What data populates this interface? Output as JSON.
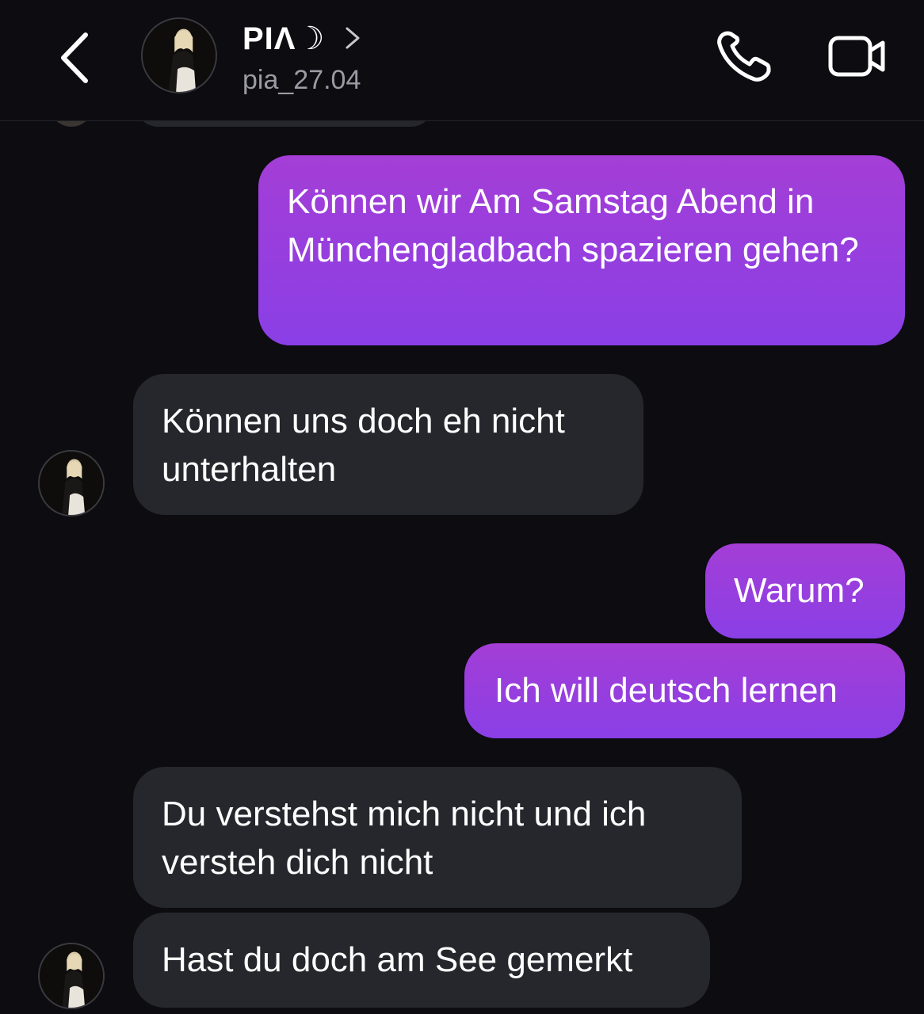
{
  "header": {
    "contact_name": "PIΛ☽",
    "contact_handle": "pia_27.04",
    "icons": {
      "back": "chevron-left-icon",
      "profile": "chevron-right-icon",
      "call": "phone-icon",
      "video": "video-camera-icon"
    }
  },
  "messages": [
    {
      "direction": "outgoing",
      "text": "Können wir Am Samstag Abend in Münchengladbach spazieren gehen?"
    },
    {
      "direction": "incoming",
      "text": "Können uns doch eh nicht unterhalten"
    },
    {
      "direction": "outgoing",
      "text": "Warum?"
    },
    {
      "direction": "outgoing",
      "text": "Ich will deutsch lernen"
    },
    {
      "direction": "incoming",
      "text": "Du verstehst mich nicht und ich versteh dich nicht"
    },
    {
      "direction": "incoming",
      "text": "Hast du doch am See gemerkt"
    }
  ],
  "colors": {
    "background": "#0c0c11",
    "incoming_bubble": "#26272c",
    "outgoing_bubble_top": "#a43ed6",
    "outgoing_bubble_bottom": "#7c43ea",
    "handle_text": "#9b9ba3"
  }
}
